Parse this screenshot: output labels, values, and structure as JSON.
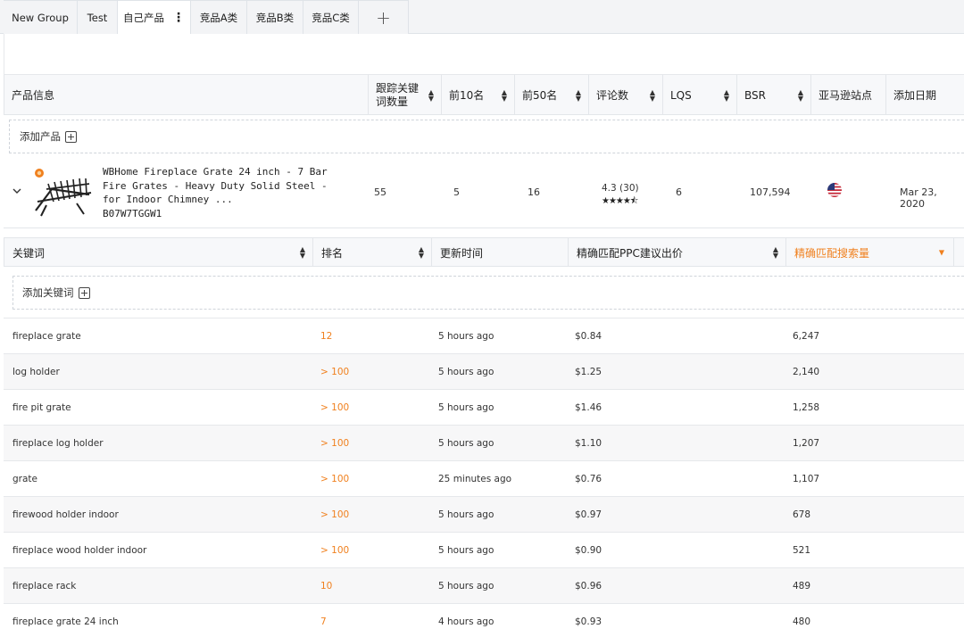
{
  "tabs": [
    {
      "label": "New Group",
      "active": false
    },
    {
      "label": "Test",
      "active": false
    },
    {
      "label": "自己产品",
      "active": true
    },
    {
      "label": "竞品A类",
      "active": false
    },
    {
      "label": "竞品B类",
      "active": false
    },
    {
      "label": "竞品C类",
      "active": false
    }
  ],
  "add_tab_icon": "plus-icon",
  "product_table": {
    "headers": {
      "info": "产品信息",
      "tracked_keywords": "跟踪关键词数量",
      "top10": "前10名",
      "top50": "前50名",
      "reviews": "评论数",
      "lqs": "LQS",
      "bsr": "BSR",
      "marketplace": "亚马逊站点",
      "date_added": "添加日期"
    },
    "add_product_label": "添加产品",
    "product": {
      "title": "WBHome Fireplace Grate 24 inch - 7 Bar Fire Grates - Heavy Duty Solid Steel - for Indoor Chimney ...",
      "asin": "B07W7TGGW1",
      "tracked_keywords": "55",
      "top10": "5",
      "top50": "16",
      "rating": "4.3 (30)",
      "stars": "★★★★⯪",
      "star_rating_value": 4.3,
      "lqs": "6",
      "bsr": "107,594",
      "marketplace_icon": "us-flag-icon",
      "date_added": "Mar 23, 2020"
    }
  },
  "keyword_table": {
    "headers": {
      "keyword": "关键词",
      "rank": "排名",
      "updated": "更新时间",
      "ppc_bid": "精确匹配PPC建议出价",
      "search_volume": "精确匹配搜索量"
    },
    "add_keyword_label": "添加关键词",
    "rows": [
      {
        "keyword": "fireplace grate",
        "rank": "12",
        "updated": "5 hours ago",
        "bid": "$0.84",
        "volume": "6,247"
      },
      {
        "keyword": "log holder",
        "rank": "> 100",
        "updated": "5 hours ago",
        "bid": "$1.25",
        "volume": "2,140"
      },
      {
        "keyword": "fire pit grate",
        "rank": "> 100",
        "updated": "5 hours ago",
        "bid": "$1.46",
        "volume": "1,258"
      },
      {
        "keyword": "fireplace log holder",
        "rank": "> 100",
        "updated": "5 hours ago",
        "bid": "$1.10",
        "volume": "1,207"
      },
      {
        "keyword": "grate",
        "rank": "> 100",
        "updated": "25 minutes ago",
        "bid": "$0.76",
        "volume": "1,107"
      },
      {
        "keyword": "firewood holder indoor",
        "rank": "> 100",
        "updated": "5 hours ago",
        "bid": "$0.97",
        "volume": "678"
      },
      {
        "keyword": "fireplace wood holder indoor",
        "rank": "> 100",
        "updated": "5 hours ago",
        "bid": "$0.90",
        "volume": "521"
      },
      {
        "keyword": "fireplace rack",
        "rank": "10",
        "updated": "5 hours ago",
        "bid": "$0.96",
        "volume": "489"
      },
      {
        "keyword": "fireplace grate 24 inch",
        "rank": "7",
        "updated": "4 hours ago",
        "bid": "$0.93",
        "volume": "480"
      }
    ]
  },
  "colors": {
    "accent": "#f0801e",
    "header_bg": "#f7f8fa",
    "border": "#e3e6ea"
  }
}
